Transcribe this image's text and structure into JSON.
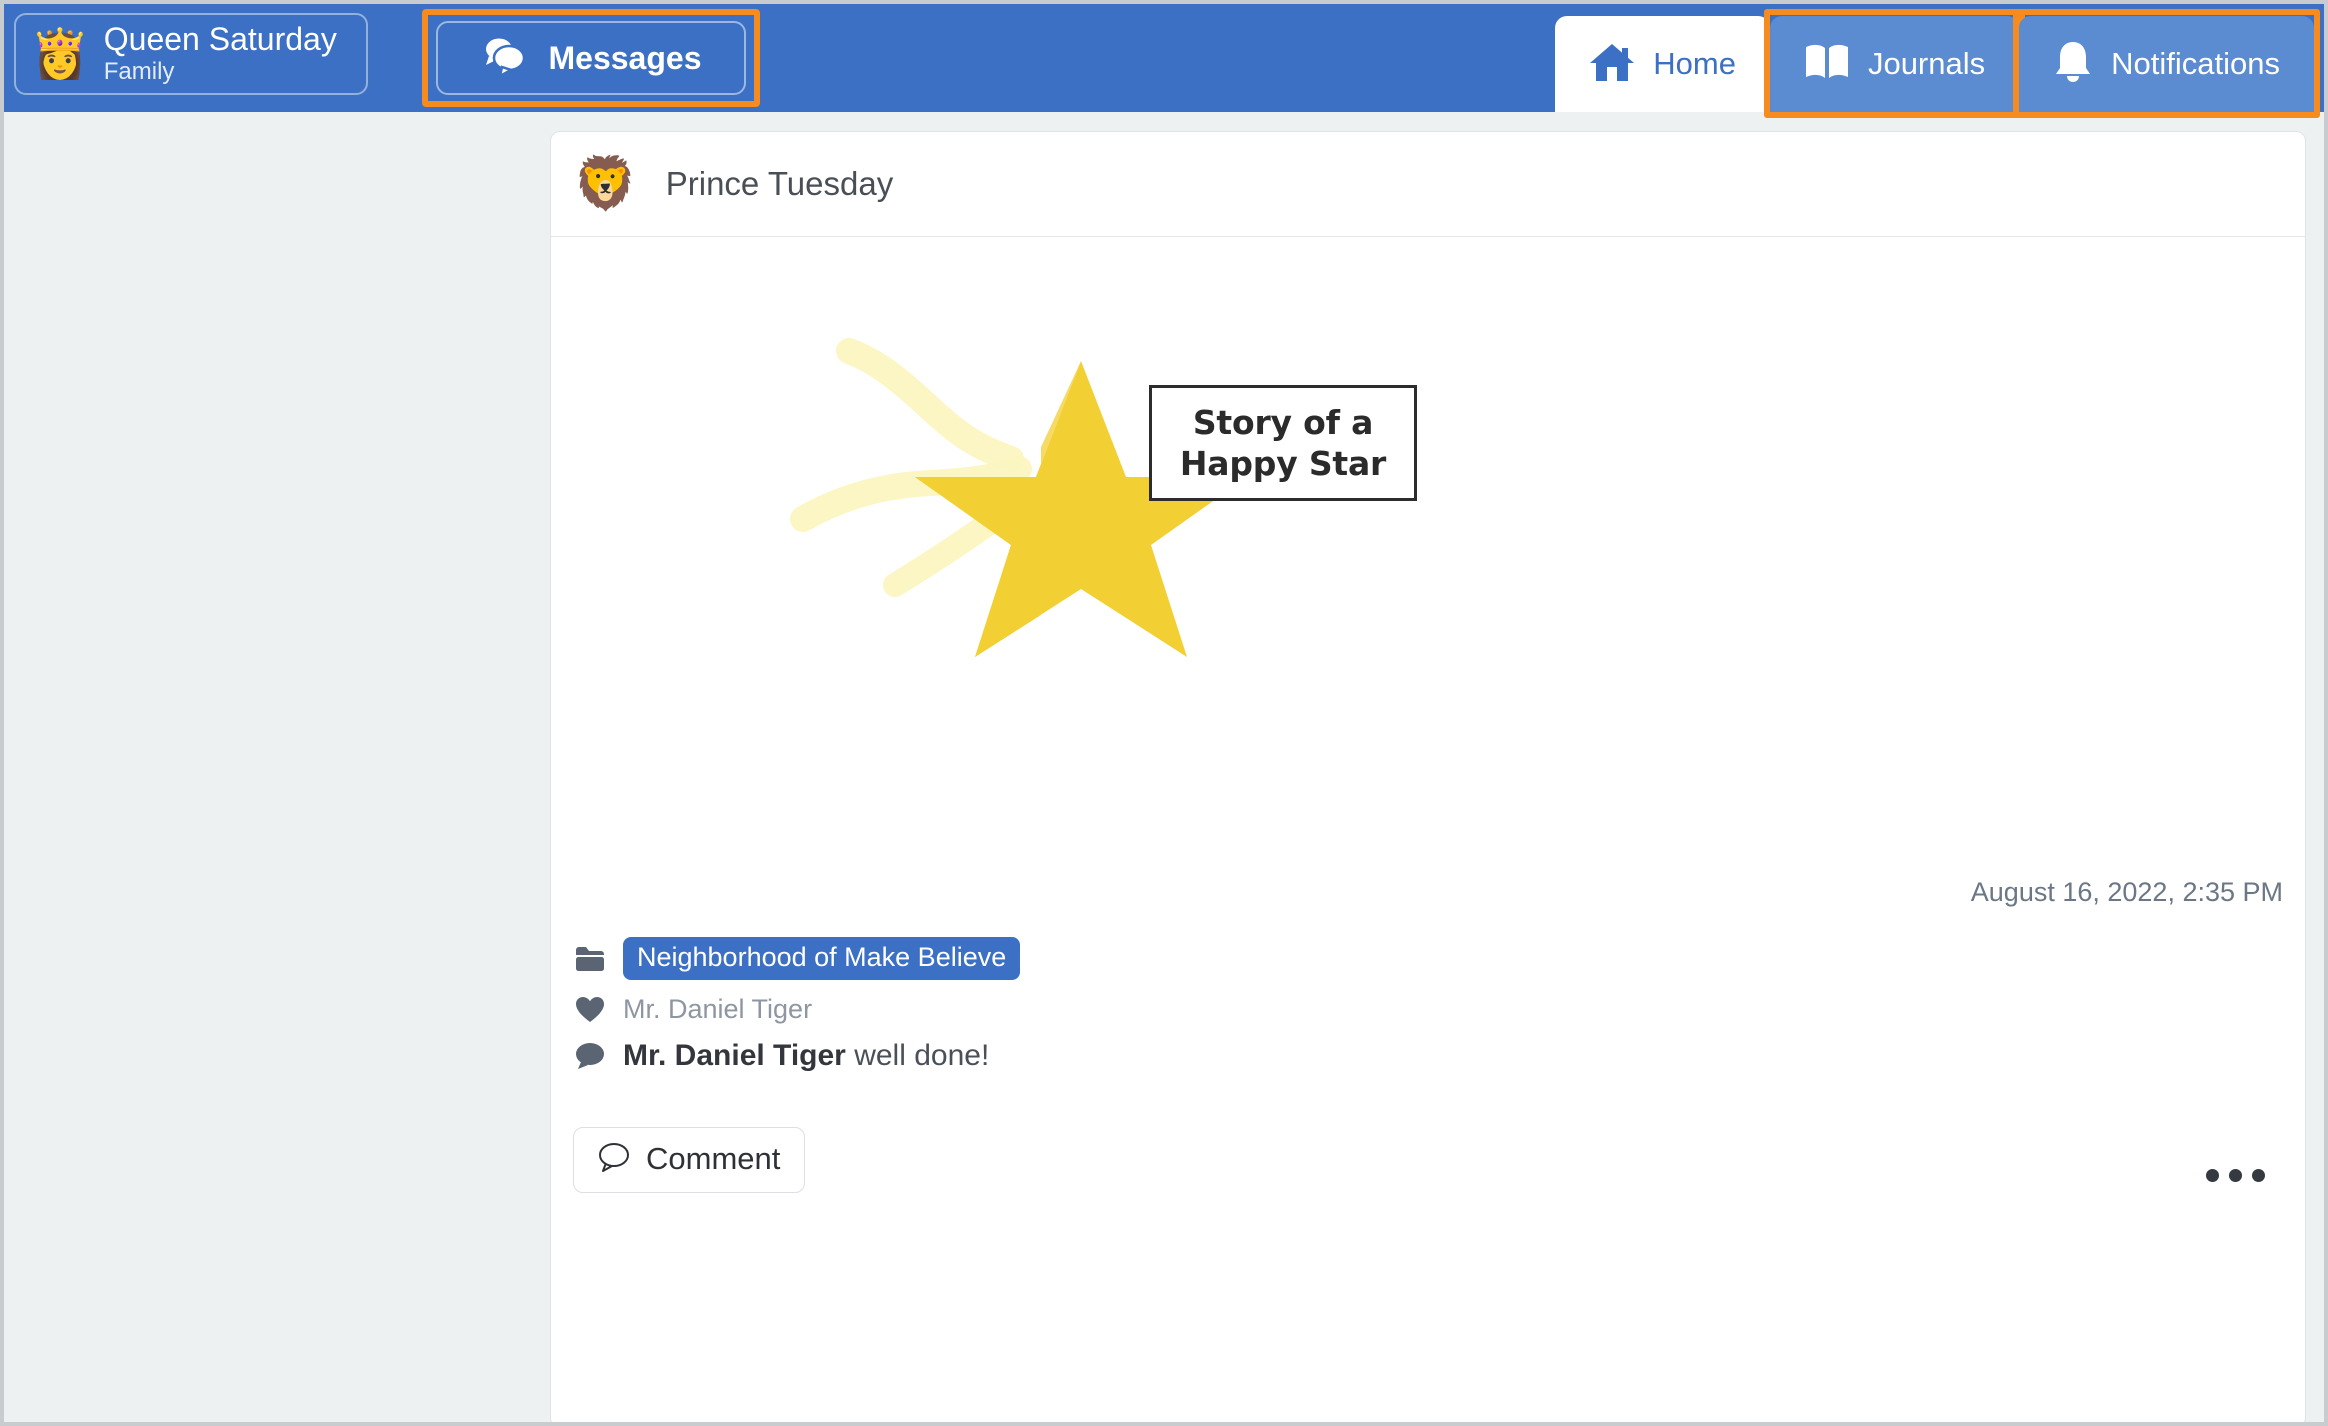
{
  "colors": {
    "header_blue": "#3b70c4",
    "tab_inactive_blue": "#5b8bd0",
    "highlight_orange": "#f68b1f",
    "page_bg": "#edf1f2",
    "card_white": "#ffffff",
    "tag_blue": "#3b70c4",
    "icon_slate": "#5a6472",
    "star_yellow": "#f2cf33",
    "star_trail": "#f7f0a8"
  },
  "header": {
    "user": {
      "avatar_icon": "queen-emoji",
      "avatar_glyph": "👸",
      "name": "Queen Saturday",
      "role": "Family"
    },
    "messages": {
      "icon": "chat-bubbles-icon",
      "label": "Messages",
      "highlighted": true
    },
    "tabs": [
      {
        "id": "home",
        "icon": "house-icon",
        "label": "Home",
        "active": true,
        "highlighted": false
      },
      {
        "id": "journals",
        "icon": "open-book-icon",
        "label": "Journals",
        "active": false,
        "highlighted": true
      },
      {
        "id": "notifications",
        "icon": "bell-icon",
        "label": "Notifications",
        "active": false,
        "highlighted": true
      }
    ]
  },
  "post": {
    "author": {
      "avatar_icon": "lion-emoji",
      "avatar_glyph": "🦁",
      "name": "Prince Tuesday"
    },
    "media": {
      "type": "illustration",
      "description": "shooting-star-illustration",
      "title_line1": "Story of a",
      "title_line2": "Happy Star"
    },
    "timestamp": "August 16, 2022, 2:35 PM",
    "tag": {
      "icon": "folder-icon",
      "label": "Neighborhood of Make Believe"
    },
    "like": {
      "icon": "heart-icon",
      "by": "Mr. Daniel Tiger"
    },
    "comment": {
      "icon": "comment-bubble-icon",
      "author": "Mr. Daniel Tiger",
      "text": "well done!"
    },
    "comment_button": {
      "icon": "comment-bubble-outline-icon",
      "label": "Comment"
    },
    "more_menu": {
      "icon": "ellipsis-icon",
      "label": "•••"
    }
  }
}
